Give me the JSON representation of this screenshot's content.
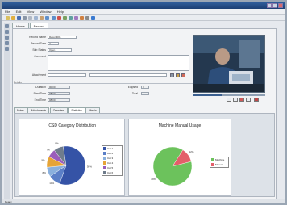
{
  "window": {
    "title": ""
  },
  "menu": {
    "items": [
      "File",
      "Edit",
      "View",
      "Window",
      "Help"
    ]
  },
  "doc_tabs": [
    {
      "label": "Home"
    },
    {
      "label": "Record"
    }
  ],
  "form": {
    "left": [
      {
        "label": "Record Name",
        "value": "Record001"
      },
      {
        "label": "Record Date",
        "value": "2"
      },
      {
        "label": "Sub Status",
        "value": "Open"
      },
      {
        "label": "Comment",
        "value": ""
      },
      {
        "label": "Attachment",
        "value": ""
      }
    ]
  },
  "metrics": {
    "header": "Details",
    "left": [
      {
        "label": "Duration",
        "value": "00:00"
      },
      {
        "label": "Start Time",
        "value": "08:00"
      },
      {
        "label": "End Time",
        "value": "08:00"
      }
    ],
    "right": [
      {
        "label": "Elapsed",
        "value": "0"
      },
      {
        "label": "Total",
        "value": ""
      }
    ]
  },
  "video": {
    "progress": 0.4
  },
  "bottom_tabs": [
    {
      "label": "Notes"
    },
    {
      "label": "Attachments"
    },
    {
      "label": "Overview"
    },
    {
      "label": "Statistics"
    },
    {
      "label": "Media"
    }
  ],
  "colors": {
    "pie1": [
      "#3553a6",
      "#5b7fc7",
      "#8ab0dd",
      "#e6a437",
      "#9a5dbb",
      "#6f7c8c"
    ],
    "pie2": [
      "#6cc25c",
      "#e35f6a"
    ]
  },
  "chart_data": [
    {
      "type": "pie",
      "title": "ICSD Category Distribution",
      "categories": [
        "Cat 1",
        "Cat 2",
        "Cat 3",
        "Cat 4",
        "Cat 5",
        "Cat 6"
      ],
      "values": [
        58,
        10,
        8,
        9,
        7,
        8
      ],
      "slice_labels": [
        "58%",
        "10%",
        "8%",
        "9%",
        "7%",
        "8%"
      ],
      "legend": "right"
    },
    {
      "type": "pie",
      "title": "Machine Manual Usage",
      "categories": [
        "Machine",
        "Manual"
      ],
      "values": [
        88,
        12
      ],
      "slice_labels": [
        "88%",
        "12%"
      ],
      "legend": "right"
    }
  ],
  "status": [
    "Ready",
    "",
    ""
  ]
}
